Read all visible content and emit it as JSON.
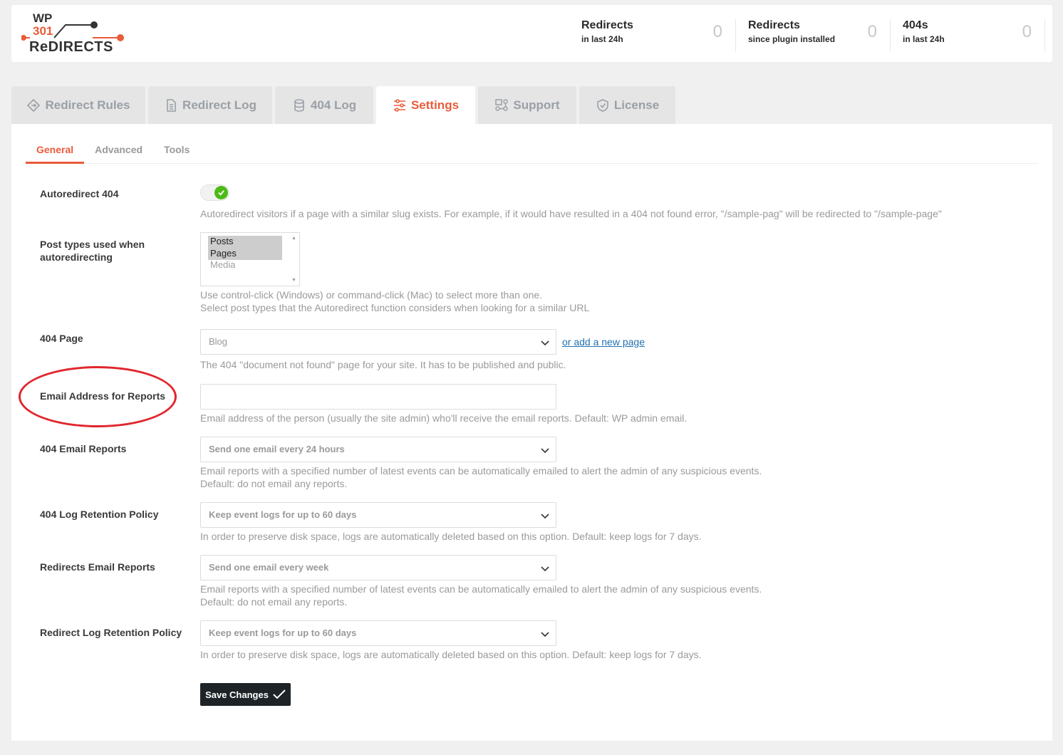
{
  "header": {
    "logo_text": {
      "line1": "WP",
      "line2": "301",
      "line3": "ReDIRECTS"
    },
    "stats": [
      {
        "title": "Redirects",
        "subtitle": "in last 24h",
        "value": "0"
      },
      {
        "title": "Redirects",
        "subtitle": "since plugin installed",
        "value": "0"
      },
      {
        "title": "404s",
        "subtitle": "in last 24h",
        "value": "0"
      }
    ]
  },
  "tabs": [
    {
      "label": "Redirect Rules",
      "icon": "diamond-arrows-icon"
    },
    {
      "label": "Redirect Log",
      "icon": "document-icon"
    },
    {
      "label": "404 Log",
      "icon": "database-icon"
    },
    {
      "label": "Settings",
      "icon": "sliders-icon",
      "active": true
    },
    {
      "label": "Support",
      "icon": "support-icon"
    },
    {
      "label": "License",
      "icon": "shield-check-icon"
    }
  ],
  "subtabs": [
    "General",
    "Advanced",
    "Tools"
  ],
  "settings": {
    "autoredirect": {
      "label": "Autoredirect 404",
      "help": "Autoredirect visitors if a page with a similar slug exists. For example, if it would have resulted in a 404 not found error, \"/sample-pag\" will be redirected to \"/sample-page\"",
      "enabled": true
    },
    "post_types": {
      "label_line1": "Post types used when",
      "label_line2": "autoredirecting",
      "options": [
        "Posts",
        "Pages",
        "Media"
      ],
      "selected": [
        "Posts",
        "Pages"
      ],
      "help_line1": "Use control-click (Windows) or command-click (Mac) to select more than one.",
      "help_line2": "Select post types that the Autoredirect function considers when looking for a similar URL"
    },
    "page404": {
      "label": "404 Page",
      "value": "Blog",
      "add_link": "or add a new page",
      "help": "The 404 \"document not found\" page for your site. It has to be published and public."
    },
    "email": {
      "label": "Email Address for Reports",
      "value": "",
      "help": "Email address of the person (usually the site admin) who'll receive the email reports. Default: WP admin email."
    },
    "email404": {
      "label": "404 Email Reports",
      "value": "Send one email every 24 hours",
      "help_line1": "Email reports with a specified number of latest events can be automatically emailed to alert the admin of any suspicious events.",
      "help_line2": "Default: do not email any reports."
    },
    "retention404": {
      "label": "404 Log Retention Policy",
      "value": "Keep event logs for up to 60 days",
      "help": "In order to preserve disk space, logs are automatically deleted based on this option. Default: keep logs for 7 days."
    },
    "redirect_email": {
      "label": "Redirects Email Reports",
      "value": "Send one email every week",
      "help_line1": "Email reports with a specified number of latest events can be automatically emailed to alert the admin of any suspicious events.",
      "help_line2": "Default: do not email any reports."
    },
    "redirect_retention": {
      "label": "Redirect Log Retention Policy",
      "value": "Keep event logs for up to 60 days",
      "help": "In order to preserve disk space, logs are automatically deleted based on this option. Default: keep logs for 7 days."
    }
  },
  "save_label": "Save Changes",
  "colors": {
    "accent": "#ea5b3a",
    "toggle_on": "#4cbb17",
    "highlight": "#e1262d",
    "button": "#1d2327"
  }
}
